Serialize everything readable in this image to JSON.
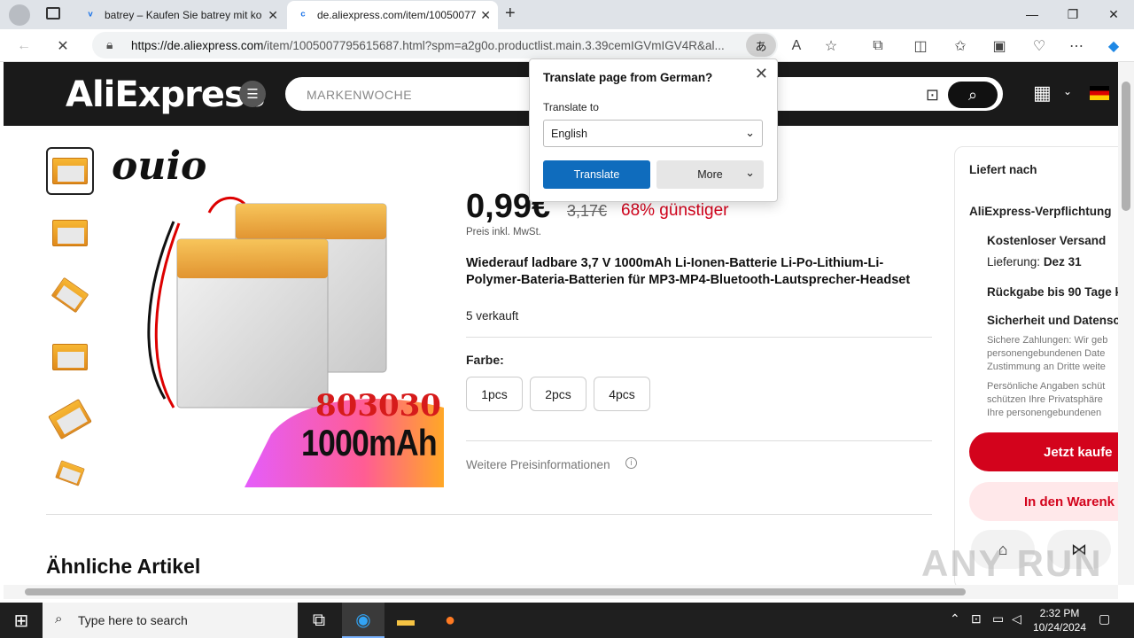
{
  "browser": {
    "tabs": [
      {
        "title": "batrey – Kaufen Sie batrey mit ko",
        "active": false
      },
      {
        "title": "de.aliexpress.com/item/10050077",
        "active": true
      }
    ],
    "new_tab": "+",
    "url_domain": "https://de.aliexpress.com",
    "url_rest": "/item/1005007795615687.html?spm=a2g0o.productlist.main.3.39cemIGVmIGV4R&al...",
    "window_controls": {
      "minimize": "—",
      "maximize": "❐",
      "close": "✕"
    }
  },
  "translate_popup": {
    "title": "Translate page from German?",
    "translate_to_label": "Translate to",
    "language": "English",
    "translate_button": "Translate",
    "more_button": "More"
  },
  "header": {
    "logo": "AliExpress",
    "search_placeholder": "MARKENWOCHE"
  },
  "product": {
    "brand_text": "ouio",
    "image_text_model": "803030",
    "image_text_capacity": "1000mAh",
    "price": "0,99€",
    "old_price": "3,17€",
    "discount": "68% günstiger",
    "vat_note": "Preis inkl. MwSt.",
    "title": "Wiederauf ladbare 3,7 V 1000mAh Li-Ionen-Batterie Li-Po-Lithium-Li-Polymer-Bateria-Batterien für MP3-MP4-Bluetooth-Lautsprecher-Headset",
    "sold": "5 verkauft",
    "color_label": "Farbe:",
    "options": [
      "1pcs",
      "2pcs",
      "4pcs"
    ],
    "more_price_info": "Weitere Preisinformationen"
  },
  "similar_heading": "Ähnliche Artikel",
  "right_panel": {
    "ships_to": "Liefert nach",
    "commitment": "AliExpress-Verpflichtung",
    "free_shipping": "Kostenloser Versand",
    "delivery_label": "Lieferung:",
    "delivery_date": "Dez 31",
    "returns": "Rückgabe bis 90 Tage k",
    "security": "Sicherheit und Datensc",
    "security_lines_1": [
      "Sichere Zahlungen: Wir geb",
      "personengebundenen Date",
      "Zustimmung an Dritte weite"
    ],
    "security_lines_2": [
      "Persönliche Angaben schüt",
      "schützen Ihre Privatsphäre",
      "Ihre personengebundenen"
    ],
    "buy_now": "Jetzt kaufe",
    "add_to_cart": "In den Warenk"
  },
  "taskbar": {
    "search_placeholder": "Type here to search",
    "time": "2:32 PM",
    "date": "10/24/2024"
  },
  "watermark": "ANY RUN"
}
